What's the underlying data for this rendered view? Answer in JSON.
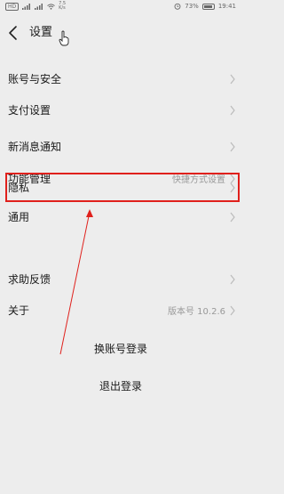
{
  "status_bar": {
    "left_chip": "HD",
    "speed_top": "7.5",
    "speed_bottom": "K/s",
    "battery_percent": "73%",
    "time": "19:41",
    "battery_level": 0.73
  },
  "header": {
    "title": "设置"
  },
  "settings": {
    "items": [
      {
        "label": "账号与安全",
        "value": ""
      },
      {
        "label": "支付设置",
        "value": ""
      },
      {
        "label": "新消息通知",
        "value": ""
      },
      {
        "label": "功能管理",
        "value": "快捷方式设置"
      },
      {
        "label": "隐私",
        "value": ""
      },
      {
        "label": "通用",
        "value": ""
      },
      {
        "label": "求助反馈",
        "value": ""
      },
      {
        "label": "关于",
        "value": "版本号 10.2.6"
      }
    ]
  },
  "actions": {
    "switch_account": "换账号登录",
    "logout": "退出登录"
  },
  "annotation": {
    "color": "#e0201c"
  }
}
